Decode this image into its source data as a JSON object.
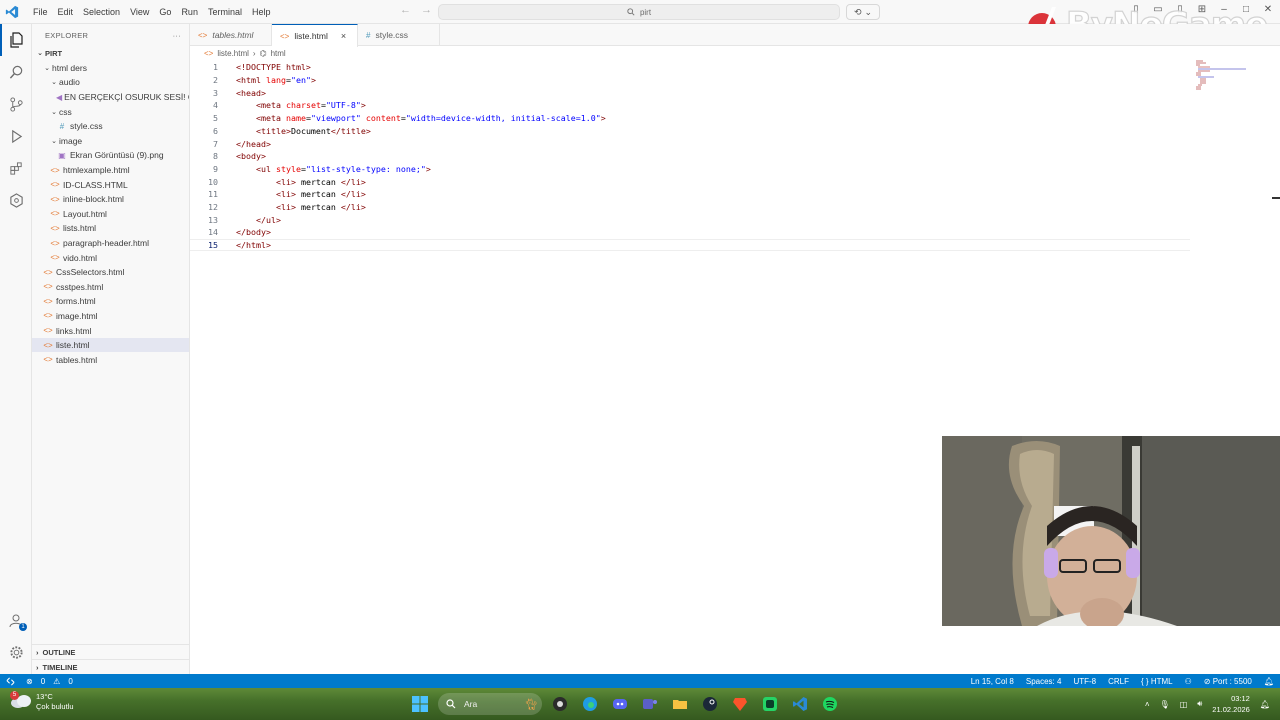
{
  "menu": [
    "File",
    "Edit",
    "Selection",
    "View",
    "Go",
    "Run",
    "Terminal",
    "Help"
  ],
  "search": {
    "text": "pirt"
  },
  "watermark": {
    "text": "ByNoGame"
  },
  "sidebar": {
    "header": "EXPLORER",
    "root": "PIRT",
    "items": [
      {
        "label": "html ders",
        "depth": 1,
        "type": "folder"
      },
      {
        "label": "audio",
        "depth": 2,
        "type": "folder"
      },
      {
        "label": "EN GERÇEKÇİ OSURUK SESİ! O...",
        "depth": 3,
        "type": "audio"
      },
      {
        "label": "css",
        "depth": 2,
        "type": "folder"
      },
      {
        "label": "style.css",
        "depth": 3,
        "type": "css"
      },
      {
        "label": "image",
        "depth": 2,
        "type": "folder"
      },
      {
        "label": "Ekran Görüntüsü (9).png",
        "depth": 3,
        "type": "img"
      },
      {
        "label": "htmlexample.html",
        "depth": 2,
        "type": "html"
      },
      {
        "label": "ID-CLASS.HTML",
        "depth": 2,
        "type": "html"
      },
      {
        "label": "inline-block.html",
        "depth": 2,
        "type": "html"
      },
      {
        "label": "Layout.html",
        "depth": 2,
        "type": "html"
      },
      {
        "label": "lists.html",
        "depth": 2,
        "type": "html"
      },
      {
        "label": "paragraph-header.html",
        "depth": 2,
        "type": "html"
      },
      {
        "label": "vido.html",
        "depth": 2,
        "type": "html"
      },
      {
        "label": "CssSelectors.html",
        "depth": 1,
        "type": "html"
      },
      {
        "label": "csstpes.html",
        "depth": 1,
        "type": "html"
      },
      {
        "label": "forms.html",
        "depth": 1,
        "type": "html"
      },
      {
        "label": "image.html",
        "depth": 1,
        "type": "html"
      },
      {
        "label": "links.html",
        "depth": 1,
        "type": "html"
      },
      {
        "label": "liste.html",
        "depth": 1,
        "type": "html",
        "selected": true
      },
      {
        "label": "tables.html",
        "depth": 1,
        "type": "html"
      }
    ],
    "outline": "OUTLINE",
    "timeline": "TIMELINE"
  },
  "tabs": [
    {
      "label": "tables.html",
      "icon": "<>",
      "italic": true,
      "active": false
    },
    {
      "label": "liste.html",
      "icon": "<>",
      "italic": false,
      "active": true,
      "close": "×"
    },
    {
      "label": "style.css",
      "icon": "#",
      "italic": false,
      "active": false
    }
  ],
  "breadcrumb": [
    "liste.html",
    "html"
  ],
  "editor": {
    "current_line": 15,
    "lines": [
      [
        [
          "t-tag",
          "<!DOCTYPE html>"
        ]
      ],
      [
        [
          "t-tag",
          "<html "
        ],
        [
          "t-attr",
          "lang"
        ],
        [
          "t-txt",
          "="
        ],
        [
          "t-str",
          "\"en\""
        ],
        [
          "t-tag",
          ">"
        ]
      ],
      [
        [
          "t-tag",
          "<head>"
        ]
      ],
      [
        [
          "t-txt",
          "    "
        ],
        [
          "t-tag",
          "<meta "
        ],
        [
          "t-attr",
          "charset"
        ],
        [
          "t-txt",
          "="
        ],
        [
          "t-str",
          "\"UTF-8\""
        ],
        [
          "t-tag",
          ">"
        ]
      ],
      [
        [
          "t-txt",
          "    "
        ],
        [
          "t-tag",
          "<meta "
        ],
        [
          "t-attr",
          "name"
        ],
        [
          "t-txt",
          "="
        ],
        [
          "t-str",
          "\"viewport\""
        ],
        [
          "t-txt",
          " "
        ],
        [
          "t-attr",
          "content"
        ],
        [
          "t-txt",
          "="
        ],
        [
          "t-str",
          "\"width=device-width, initial-scale=1.0\""
        ],
        [
          "t-tag",
          ">"
        ]
      ],
      [
        [
          "t-txt",
          "    "
        ],
        [
          "t-tag",
          "<title>"
        ],
        [
          "t-txt",
          "Document"
        ],
        [
          "t-tag",
          "</title>"
        ]
      ],
      [
        [
          "t-tag",
          "</head>"
        ]
      ],
      [
        [
          "t-tag",
          "<body>"
        ]
      ],
      [
        [
          "t-txt",
          "    "
        ],
        [
          "t-tag",
          "<ul "
        ],
        [
          "t-attr",
          "style"
        ],
        [
          "t-txt",
          "="
        ],
        [
          "t-str",
          "\"list-style-type: none;\""
        ],
        [
          "t-tag",
          ">"
        ]
      ],
      [
        [
          "t-txt",
          "        "
        ],
        [
          "t-tag",
          "<li>"
        ],
        [
          "t-txt",
          " mertcan "
        ],
        [
          "t-tag",
          "</li>"
        ]
      ],
      [
        [
          "t-txt",
          "        "
        ],
        [
          "t-tag",
          "<li>"
        ],
        [
          "t-txt",
          " mertcan "
        ],
        [
          "t-tag",
          "</li>"
        ]
      ],
      [
        [
          "t-txt",
          "        "
        ],
        [
          "t-tag",
          "<li>"
        ],
        [
          "t-txt",
          " mertcan "
        ],
        [
          "t-tag",
          "</li>"
        ]
      ],
      [
        [
          "t-txt",
          "    "
        ],
        [
          "t-tag",
          "</ul>"
        ]
      ],
      [
        [
          "t-tag",
          "</body>"
        ]
      ],
      [
        [
          "t-tag",
          "</html>"
        ]
      ]
    ]
  },
  "statusbar": {
    "errors": "0",
    "warnings": "0",
    "position": "Ln 15, Col 8",
    "spaces": "Spaces: 4",
    "encoding": "UTF-8",
    "eol": "CRLF",
    "language": "HTML",
    "port": "Port : 5500"
  },
  "taskbar": {
    "weather_temp": "13°C",
    "weather_desc": "Çok bulutlu",
    "weather_badge": "5",
    "search_placeholder": "Ara",
    "time": "03:12",
    "date": "21.02.2026"
  },
  "colors": {
    "accent": "#005fb8",
    "statusbar": "#007acc"
  }
}
